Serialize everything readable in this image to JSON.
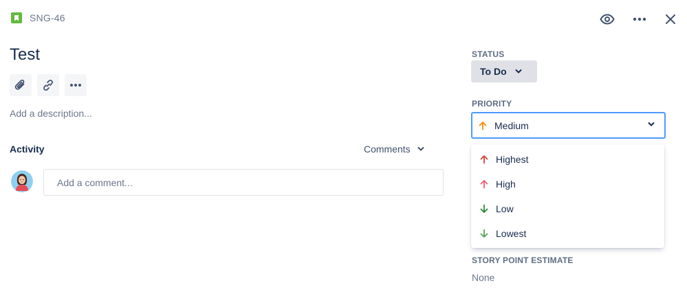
{
  "header": {
    "issue_key": "SNG-46",
    "issue_type_icon": "story-icon",
    "actions": [
      {
        "name": "watch",
        "icon": "eye-icon"
      },
      {
        "name": "more",
        "icon": "more-horizontal-icon"
      },
      {
        "name": "close",
        "icon": "close-icon"
      }
    ]
  },
  "issue": {
    "title": "Test",
    "toolbar": [
      {
        "name": "attach",
        "icon": "paperclip-icon"
      },
      {
        "name": "link",
        "icon": "link-icon"
      },
      {
        "name": "more",
        "icon": "more-horizontal-icon"
      }
    ],
    "description_placeholder": "Add a description..."
  },
  "activity": {
    "label": "Activity",
    "filter_value": "Comments",
    "comment_placeholder": "Add a comment..."
  },
  "fields": {
    "status": {
      "label": "STATUS",
      "value": "To Do"
    },
    "priority": {
      "label": "PRIORITY",
      "value": "Medium",
      "value_color": "#FF8B00",
      "options": [
        {
          "label": "Highest",
          "direction": "up",
          "color": "#D04437"
        },
        {
          "label": "High",
          "direction": "up",
          "color": "#F15C75"
        },
        {
          "label": "Low",
          "direction": "down",
          "color": "#2A8735"
        },
        {
          "label": "Lowest",
          "direction": "down",
          "color": "#55A557"
        }
      ]
    },
    "story_point_estimate": {
      "label": "STORY POINT ESTIMATE",
      "value": "None"
    }
  },
  "colors": {
    "story_green": "#63BA3C",
    "focus_blue": "#4C9AFF",
    "text_primary": "#172B4D",
    "text_subtle": "#6B778C"
  }
}
